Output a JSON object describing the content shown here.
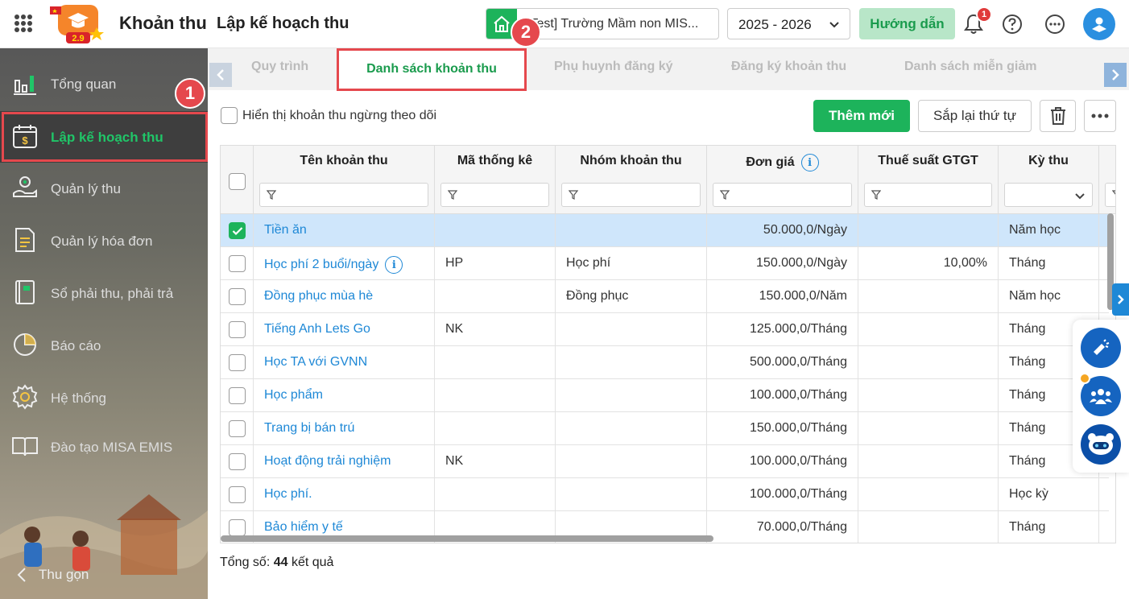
{
  "header": {
    "module_title": "Khoản thu",
    "page_title": "Lập kế hoạch thu",
    "school_name": "[Test] Trường Mầm non MIS...",
    "school_year": "2025 - 2026",
    "guide_label": "Hướng dẫn",
    "notification_count": "1",
    "logo_badge": "2.9"
  },
  "sidebar": {
    "items": [
      {
        "label": "Tổng quan"
      },
      {
        "label": "Lập kế hoạch thu"
      },
      {
        "label": "Quản lý thu"
      },
      {
        "label": "Quản lý hóa đơn"
      },
      {
        "label": "Sổ phải thu, phải trả"
      },
      {
        "label": "Báo cáo"
      },
      {
        "label": "Hệ thống"
      },
      {
        "label": "Đào tạo MISA EMIS"
      }
    ],
    "collapse_label": "Thu gọn"
  },
  "annotations": {
    "step1": "1",
    "step2": "2"
  },
  "tabs": [
    {
      "label": "Quy trình"
    },
    {
      "label": "Danh sách khoản thu"
    },
    {
      "label": "Phụ huynh đăng ký"
    },
    {
      "label": "Đăng ký khoản thu"
    },
    {
      "label": "Danh sách miễn giảm"
    }
  ],
  "toolbar": {
    "show_stopped_label": "Hiển thị khoản thu ngừng theo dõi",
    "add_label": "Thêm mới",
    "reorder_label": "Sắp lại thứ tự"
  },
  "table": {
    "columns": [
      "Tên khoản thu",
      "Mã thống kê",
      "Nhóm khoản thu",
      "Đơn giá",
      "Thuế suất GTGT",
      "Kỳ thu"
    ],
    "rows": [
      {
        "name": "Tiền ăn",
        "code": "",
        "group": "",
        "price": "50.000,0/Ngày",
        "vat": "",
        "period": "Năm học",
        "checked": true,
        "info": false
      },
      {
        "name": "Học phí 2 buổi/ngày",
        "code": "HP",
        "group": "Học phí",
        "price": "150.000,0/Ngày",
        "vat": "10,00%",
        "period": "Tháng",
        "checked": false,
        "info": true
      },
      {
        "name": "Đồng phục mùa hè",
        "code": "",
        "group": "Đồng phục",
        "price": "150.000,0/Năm",
        "vat": "",
        "period": "Năm học",
        "checked": false,
        "info": false
      },
      {
        "name": "Tiếng Anh Lets Go",
        "code": "NK",
        "group": "",
        "price": "125.000,0/Tháng",
        "vat": "",
        "period": "Tháng",
        "checked": false,
        "info": false
      },
      {
        "name": "Học TA với GVNN",
        "code": "",
        "group": "",
        "price": "500.000,0/Tháng",
        "vat": "",
        "period": "Tháng",
        "checked": false,
        "info": false
      },
      {
        "name": "Học phẩm",
        "code": "",
        "group": "",
        "price": "100.000,0/Tháng",
        "vat": "",
        "period": "Tháng",
        "checked": false,
        "info": false
      },
      {
        "name": "Trang bị bán trú",
        "code": "",
        "group": "",
        "price": "150.000,0/Tháng",
        "vat": "",
        "period": "Tháng",
        "checked": false,
        "info": false
      },
      {
        "name": "Hoạt động trải nghiệm",
        "code": "NK",
        "group": "",
        "price": "100.000,0/Tháng",
        "vat": "",
        "period": "Tháng",
        "checked": false,
        "info": false
      },
      {
        "name": "Học phí.",
        "code": "",
        "group": "",
        "price": "100.000,0/Tháng",
        "vat": "",
        "period": "Học kỳ",
        "checked": false,
        "info": false
      },
      {
        "name": "Bảo hiểm y tế",
        "code": "",
        "group": "",
        "price": "70.000,0/Tháng",
        "vat": "",
        "period": "Tháng",
        "checked": false,
        "info": false
      }
    ]
  },
  "footer": {
    "total_prefix": "Tổng số:",
    "total_count": "44",
    "total_suffix": "kết quả"
  },
  "colors": {
    "accent": "#1db35b",
    "link": "#1e88d6",
    "annotation": "#e5484d",
    "selected_row": "#cfe6fb"
  }
}
